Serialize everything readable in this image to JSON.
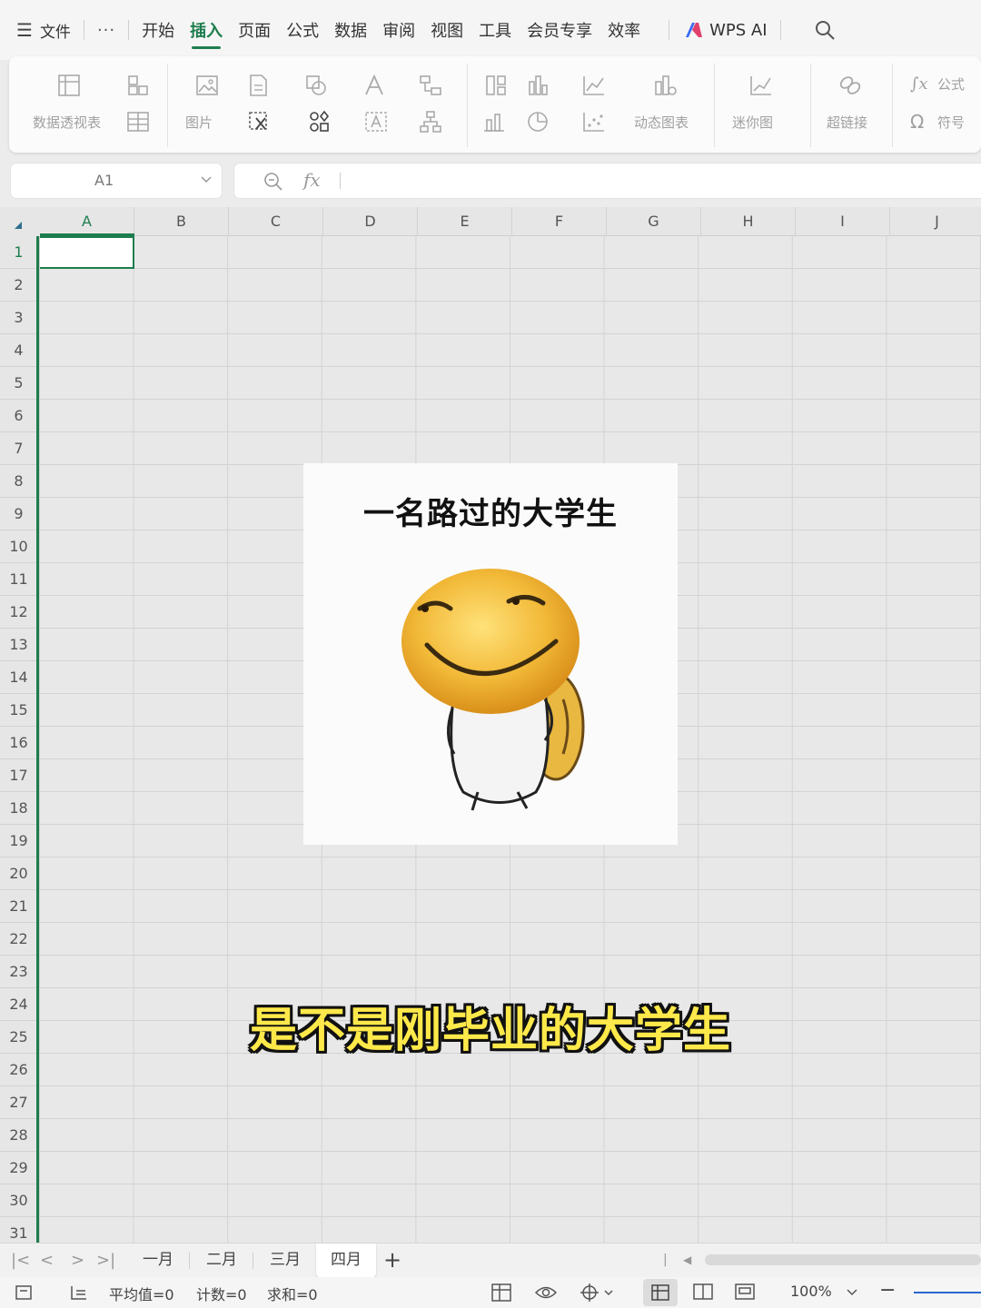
{
  "menubar": {
    "file_label": "文件",
    "more_label": "···",
    "tabs": [
      {
        "label": "开始"
      },
      {
        "label": "插入"
      },
      {
        "label": "页面"
      },
      {
        "label": "公式"
      },
      {
        "label": "数据"
      },
      {
        "label": "审阅"
      },
      {
        "label": "视图"
      },
      {
        "label": "工具"
      },
      {
        "label": "会员专享"
      },
      {
        "label": "效率"
      }
    ],
    "active_tab": "插入",
    "ai_label": "WPS AI"
  },
  "ribbon": {
    "pivot_table": "数据透视表",
    "picture": "图片",
    "dynamic_chart": "动态图表",
    "sparkline": "迷你图",
    "hyperlink": "超链接",
    "formula": "公式",
    "symbol": "符号"
  },
  "namebox": {
    "value": "A1"
  },
  "formula": {
    "fx_label": "fx",
    "value": ""
  },
  "grid": {
    "columns": [
      "A",
      "B",
      "C",
      "D",
      "E",
      "F",
      "G",
      "H",
      "I",
      "J"
    ],
    "rows": [
      "1",
      "2",
      "3",
      "4",
      "5",
      "6",
      "7",
      "8",
      "9",
      "10",
      "11",
      "12",
      "13",
      "14",
      "15",
      "16",
      "17",
      "18",
      "19",
      "20",
      "21",
      "22",
      "23",
      "24",
      "25",
      "26",
      "27",
      "28",
      "29",
      "30",
      "31"
    ],
    "active_cell": "A1"
  },
  "meme": {
    "title": "一名路过的大学生"
  },
  "subtitle": "是不是刚毕业的大学生",
  "sheets": {
    "tabs": [
      "一月",
      "二月",
      "三月",
      "四月"
    ],
    "active": "四月"
  },
  "status": {
    "average": "平均值=0",
    "count": "计数=0",
    "sum": "求和=0",
    "zoom": "100%"
  },
  "colors": {
    "accent": "#1e7d4e",
    "subtitle_fill": "#ffe94a"
  }
}
